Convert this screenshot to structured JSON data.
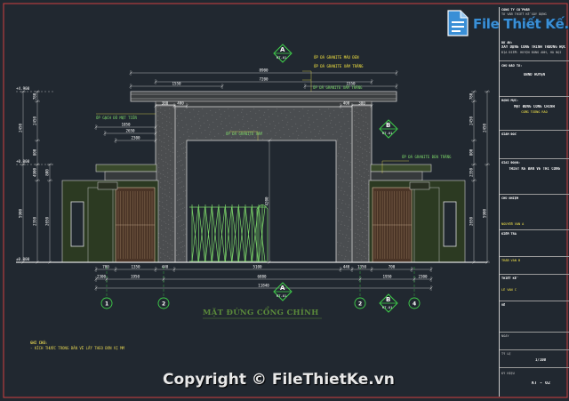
{
  "drawing": {
    "caption": "MẶT ĐỨNG CỔNG CHÍNH",
    "watermark": "Copyright © FileThietKe.vn",
    "logo": {
      "brand": "File Thiết Kế.vn"
    },
    "notes": {
      "title": "GHI CHÚ:",
      "line1": "- KÍCH THƯỚC TRONG BẢN VẼ LẤY THEO ĐƠN VỊ MM"
    },
    "section_marks": [
      {
        "letter": "A",
        "sheet": "KT-01"
      },
      {
        "letter": "B",
        "sheet": "KT-01"
      },
      {
        "letter": "A",
        "sheet": "KT-01"
      },
      {
        "letter": "B",
        "sheet": "KT-01"
      }
    ],
    "axes": [
      "1",
      "2",
      "2",
      "4"
    ],
    "labels": {
      "trim1": "ỐP ĐÁ GRANITE MÀU ĐEN",
      "trim2": "ỐP ĐÁ GRANITE XÁM TRẮNG",
      "roof": "ỐP ĐÁ GRANITE XÁM TRẮNG",
      "trim_left": "ỐP GẠCH ĐỎ MẶT TIỀN",
      "gate_mid": "ỐP ĐÁ GRANITE XÁM",
      "right_wall": "ỐP ĐÁ GRANITE ĐEN TRẮNG"
    },
    "dims_top": [
      "8900",
      "7200",
      "1550",
      "1550"
    ],
    "dims_inner": [
      "1050",
      "380",
      "400",
      "2650",
      "2300",
      "400",
      "380"
    ],
    "dims_bottom1": [
      "700",
      "1350",
      "440",
      "5100",
      "440",
      "1350",
      "700"
    ],
    "dims_bottom2": [
      "2300",
      "1950",
      "6880",
      "1950",
      "2300"
    ],
    "dims_total": "11840",
    "dims_left": [
      "780",
      "2450",
      "800",
      "4900",
      "5900",
      "2350",
      "2650"
    ],
    "dims_right": [
      "780",
      "2450",
      "800",
      "2350",
      "2650",
      "5900"
    ],
    "dims_center": "4200",
    "elev_marks": [
      "+4.900",
      "+0.000",
      "±0.000"
    ]
  },
  "title_block": {
    "company": "CÔNG TY CỔ PHẦN",
    "company2": "TƯ VẤN THIẾT KẾ XÂY DỰNG",
    "project_lbl": "DỰ ÁN:",
    "project": "XÂY DỰNG CÔNG TRÌNH TRƯỜNG HỌC",
    "project2": "ĐỊA ĐIỂM: HUYỆN ĐÔNG ANH, HÀ NỘI",
    "owner_lbl": "CHỦ ĐẦU TƯ:",
    "owner": "UBND HUYỆN",
    "hangmuc_lbl": "HẠNG MỤC:",
    "hangmuc": "MẶT ĐỨNG CỔNG CHÍNH",
    "hangmuc2": "CỔNG TƯỜNG RÀO",
    "phase_lbl": "GIAI ĐOẠN:",
    "phase": "THIẾT KẾ BẢN VẼ THI CÔNG",
    "director_lbl": "GIÁM ĐỐC",
    "chief_lbl": "CHỦ NHIỆM",
    "chief": "NGUYỄN VĂN A",
    "check_lbl": "KIỂM TRA",
    "design_lbl": "THIẾT KẾ",
    "design": "TRẦN VĂN B",
    "draw_lbl": "VẼ",
    "draw": "LÊ VĂN C",
    "date_lbl": "NGÀY",
    "scale_lbl": "TỶ LỆ",
    "scale": "1/100",
    "sheet_lbl": "KÝ HIỆU",
    "sheet": "KT - 02"
  }
}
